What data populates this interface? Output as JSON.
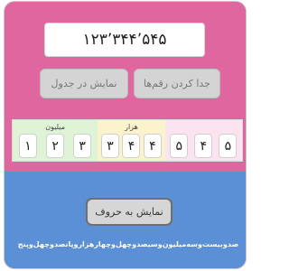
{
  "display": {
    "number": "۱۲۳٬۳۴۴٬۵۴۵"
  },
  "buttons": {
    "show_in_table": "نمایش در جدول",
    "split_digits": "جدا کردن رقم‌ها",
    "show_in_words": "نمایش به حروف"
  },
  "groups": {
    "millions": {
      "title": "میلیون",
      "digits": [
        "۱",
        "۲",
        "۳"
      ]
    },
    "thousands": {
      "title": "هزار",
      "digits": [
        "۳",
        "۴",
        "۴"
      ]
    },
    "units": {
      "title": "",
      "digits": [
        "۵",
        "۴",
        "۵"
      ]
    }
  },
  "words": "صدوبیست‌وسه‌میلیون‌وسیصدوچهل‌وچهارهزاروپانصدوچهل‌وپنج",
  "colors": {
    "top_panel": "#e066a0",
    "bottom_panel": "#5b8fd6",
    "millions_bg": "#dff3d7",
    "thousands_bg": "#fbf3cc",
    "units_bg": "#fbe4f0"
  }
}
